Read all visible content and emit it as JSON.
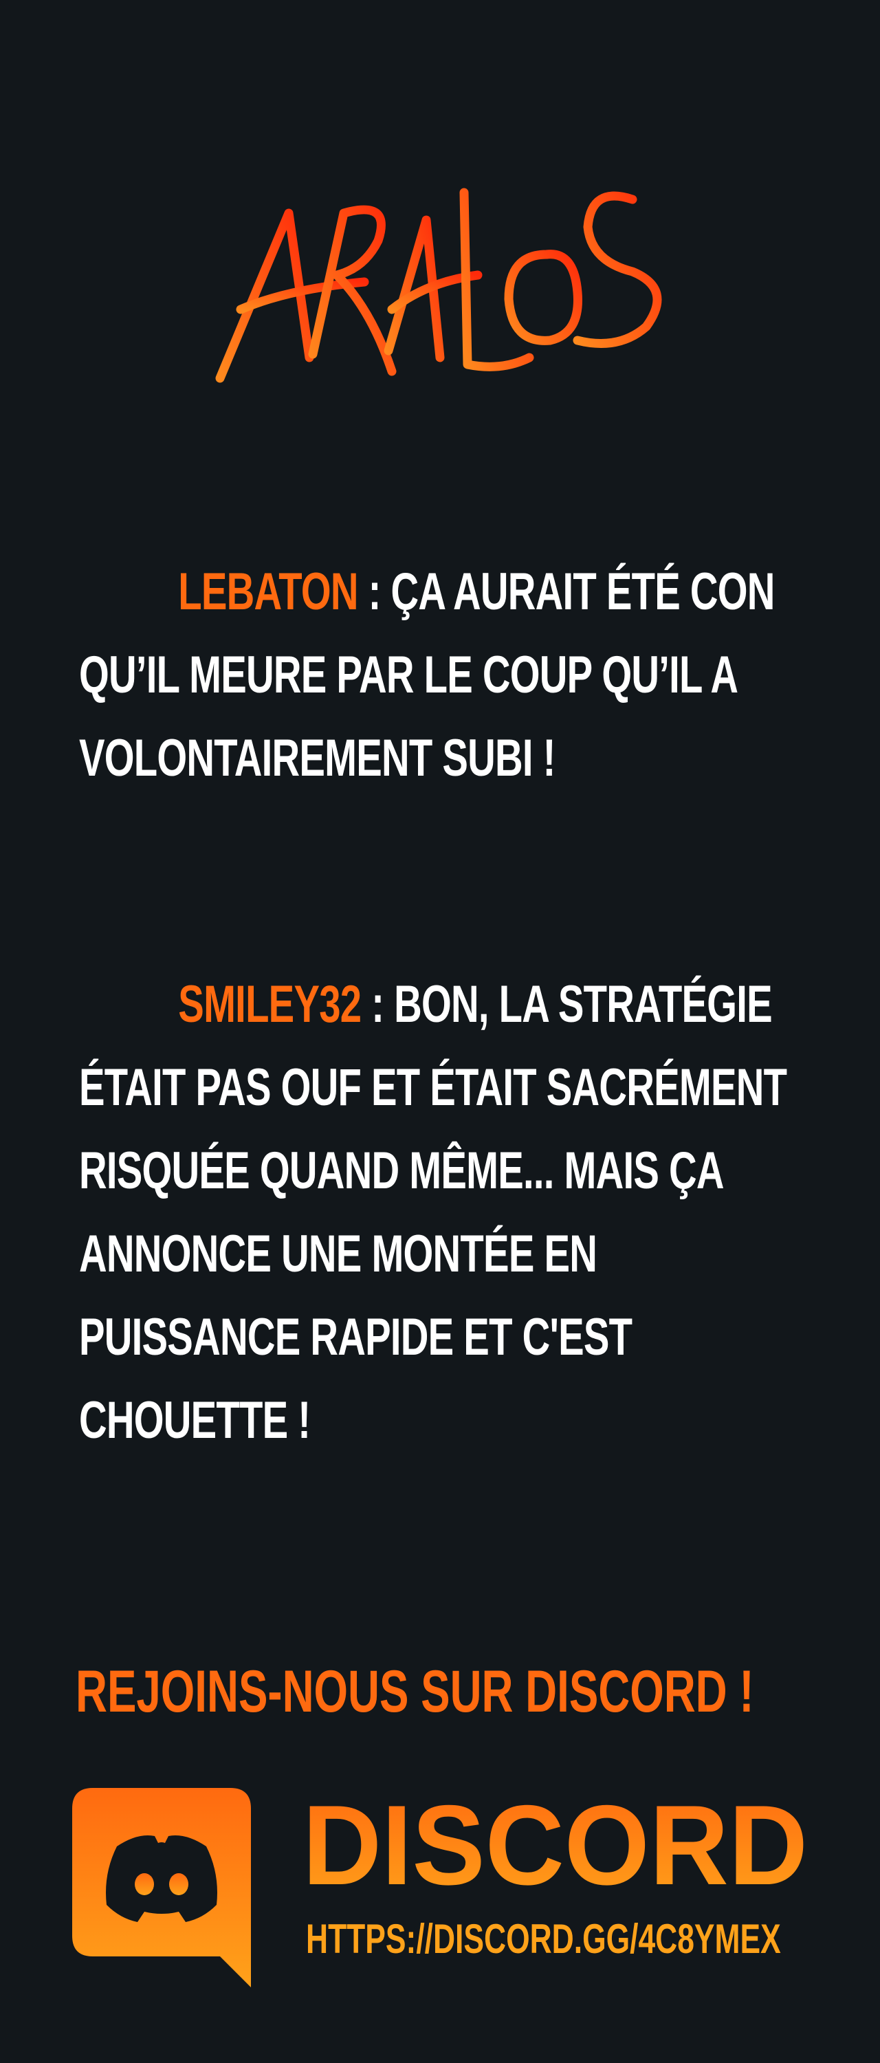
{
  "logo": {
    "text": "ARALOS",
    "gradient_start": "#ff8a1e",
    "gradient_end": "#ff2a0a"
  },
  "comments": [
    {
      "author": "LEBATON",
      "separator": " : ",
      "text": "ÇA AURAIT ÉTÉ CON QU’IL MEURE PAR LE COUP QU’IL A VOLONTAIREMENT SUBI !"
    },
    {
      "author": "SMILEY32",
      "separator": " : ",
      "text": "BON, LA STRATÉGIE ÉTAIT PAS OUF ET ÉTAIT SACRÉMENT RISQUÉE QUAND MÊME... MAIS ÇA ANNONCE UNE MONTÉE EN PUISSANCE RAPIDE ET C'EST CHOUETTE !"
    }
  ],
  "cta": {
    "label": "REJOINS-NOUS SUR DISCORD !"
  },
  "discord": {
    "wordmark": "DISCORD",
    "url": "HTTPS://DISCORD.GG/4c8YmEx",
    "icon": "discord-logo-icon",
    "gradient_top": "#ff6a10",
    "gradient_bottom": "#ffa21a"
  },
  "colors": {
    "background": "#12171b",
    "accent": "#ff6a10",
    "text": "#ffffff"
  }
}
